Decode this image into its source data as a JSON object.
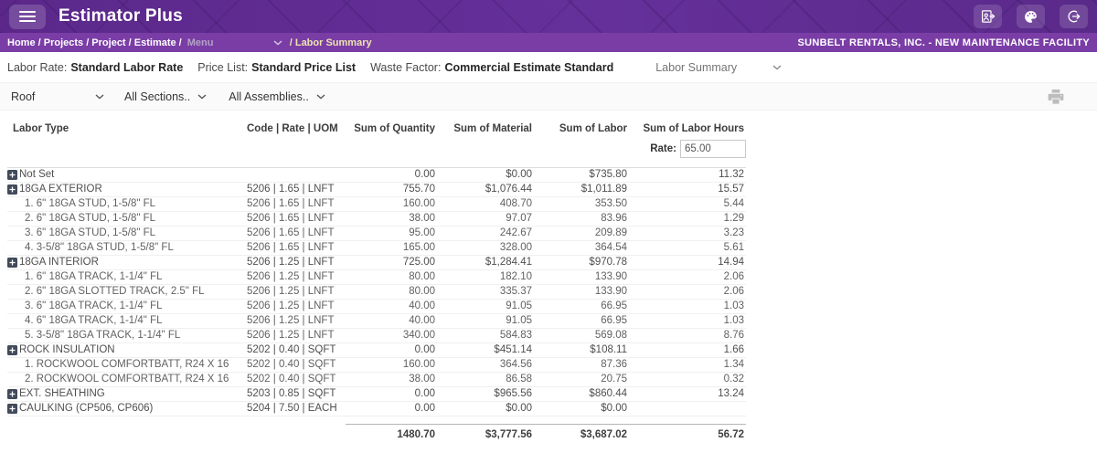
{
  "app": {
    "title": "Estimator Plus",
    "brand_colors": {
      "header_purple": "#5D2A8C",
      "breadcrumb_purple": "#7A3DA6",
      "highlight_cream": "#ECE5B0"
    }
  },
  "breadcrumb": {
    "path": "Home / Projects / Project / Estimate /",
    "menu_placeholder": "Menu",
    "current": "/ Labor Summary",
    "company": "SUNBELT RENTALS, INC. - NEW MAINTENANCE FACILITY"
  },
  "info_bar": {
    "labor_rate_label": "Labor Rate:",
    "labor_rate_value": "Standard Labor Rate",
    "price_list_label": "Price List:",
    "price_list_value": "Standard Price List",
    "waste_factor_label": "Waste Factor:",
    "waste_factor_value": "Commercial Estimate Standard",
    "view_select_value": "Labor Summary"
  },
  "filter_bar": {
    "area_select_value": "Roof",
    "sections_select_value": "All Sections..",
    "assemblies_select_value": "All Assemblies..",
    "icons": [
      "printer-icon"
    ]
  },
  "table": {
    "columns": [
      "Labor Type",
      "Code | Rate | UOM",
      "Sum of Quantity",
      "Sum of Material",
      "Sum of Labor",
      "Sum of Labor Hours"
    ],
    "rate_label": "Rate:",
    "rate_value": "65.00",
    "rows": [
      {
        "label": "Not Set",
        "code": "",
        "qty": "0.00",
        "material": "$0.00",
        "labor": "$735.80",
        "hours": "11.32",
        "level": 0,
        "expandable": true
      },
      {
        "label": "18GA EXTERIOR",
        "code": "5206 | 1.65 | LNFT",
        "qty": "755.70",
        "material": "$1,076.44",
        "labor": "$1,011.89",
        "hours": "15.57",
        "level": 0,
        "expandable": true
      },
      {
        "label": "1. 6\" 18GA STUD, 1-5/8\" FL",
        "code": "5206 | 1.65 | LNFT",
        "qty": "160.00",
        "material": "408.70",
        "labor": "353.50",
        "hours": "5.44",
        "level": 1,
        "expandable": false
      },
      {
        "label": "2. 6\" 18GA STUD, 1-5/8\" FL",
        "code": "5206 | 1.65 | LNFT",
        "qty": "38.00",
        "material": "97.07",
        "labor": "83.96",
        "hours": "1.29",
        "level": 1,
        "expandable": false
      },
      {
        "label": "3. 6\" 18GA STUD, 1-5/8\" FL",
        "code": "5206 | 1.65 | LNFT",
        "qty": "95.00",
        "material": "242.67",
        "labor": "209.89",
        "hours": "3.23",
        "level": 1,
        "expandable": false
      },
      {
        "label": "4. 3-5/8\" 18GA STUD, 1-5/8\" FL",
        "code": "5206 | 1.65 | LNFT",
        "qty": "165.00",
        "material": "328.00",
        "labor": "364.54",
        "hours": "5.61",
        "level": 1,
        "expandable": false
      },
      {
        "label": "18GA INTERIOR",
        "code": "5206 | 1.25 | LNFT",
        "qty": "725.00",
        "material": "$1,284.41",
        "labor": "$970.78",
        "hours": "14.94",
        "level": 0,
        "expandable": true
      },
      {
        "label": "1. 6\" 18GA TRACK, 1-1/4\" FL",
        "code": "5206 | 1.25 | LNFT",
        "qty": "80.00",
        "material": "182.10",
        "labor": "133.90",
        "hours": "2.06",
        "level": 1,
        "expandable": false
      },
      {
        "label": "2. 6\" 18GA SLOTTED TRACK, 2.5\" FL",
        "code": "5206 | 1.25 | LNFT",
        "qty": "80.00",
        "material": "335.37",
        "labor": "133.90",
        "hours": "2.06",
        "level": 1,
        "expandable": false
      },
      {
        "label": "3. 6\" 18GA TRACK, 1-1/4\" FL",
        "code": "5206 | 1.25 | LNFT",
        "qty": "40.00",
        "material": "91.05",
        "labor": "66.95",
        "hours": "1.03",
        "level": 1,
        "expandable": false
      },
      {
        "label": "4. 6\" 18GA TRACK, 1-1/4\" FL",
        "code": "5206 | 1.25 | LNFT",
        "qty": "40.00",
        "material": "91.05",
        "labor": "66.95",
        "hours": "1.03",
        "level": 1,
        "expandable": false
      },
      {
        "label": "5. 3-5/8\" 18GA TRACK, 1-1/4\" FL",
        "code": "5206 | 1.25 | LNFT",
        "qty": "340.00",
        "material": "584.83",
        "labor": "569.08",
        "hours": "8.76",
        "level": 1,
        "expandable": false
      },
      {
        "label": "ROCK INSULATION",
        "code": "5202 | 0.40 | SQFT",
        "qty": "0.00",
        "material": "$451.14",
        "labor": "$108.11",
        "hours": "1.66",
        "level": 0,
        "expandable": true
      },
      {
        "label": "1. ROCKWOOL COMFORTBATT, R24 X 16",
        "code": "5202 | 0.40 | SQFT",
        "qty": "160.00",
        "material": "364.56",
        "labor": "87.36",
        "hours": "1.34",
        "level": 1,
        "expandable": false
      },
      {
        "label": "2. ROCKWOOL COMFORTBATT, R24 X 16",
        "code": "5202 | 0.40 | SQFT",
        "qty": "38.00",
        "material": "86.58",
        "labor": "20.75",
        "hours": "0.32",
        "level": 1,
        "expandable": false
      },
      {
        "label": "EXT. SHEATHING",
        "code": "5203 | 0.85 | SQFT",
        "qty": "0.00",
        "material": "$965.56",
        "labor": "$860.44",
        "hours": "13.24",
        "level": 0,
        "expandable": true
      },
      {
        "label": "CAULKING (CP506, CP606)",
        "code": "5204 | 7.50 | EACH",
        "qty": "0.00",
        "material": "$0.00",
        "labor": "$0.00",
        "hours": "",
        "level": 0,
        "expandable": true
      }
    ],
    "totals": {
      "quantity": "1480.70",
      "material": "$3,777.56",
      "labor": "$3,687.02",
      "hours": "56.72"
    }
  }
}
